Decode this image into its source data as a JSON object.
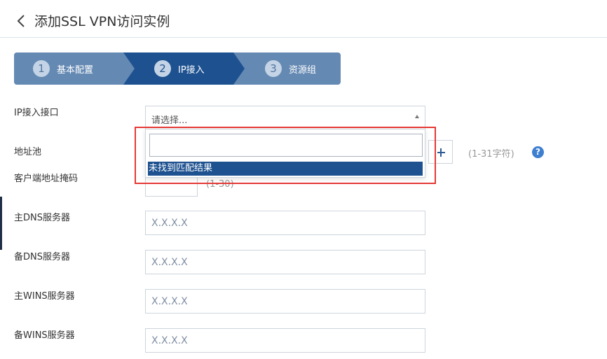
{
  "header": {
    "title": "添加SSL VPN访问实例",
    "back_icon": "chevron-left-icon"
  },
  "steps": [
    {
      "num": "1",
      "label": "基本配置",
      "state": "done"
    },
    {
      "num": "2",
      "label": "IP接入",
      "state": "active"
    },
    {
      "num": "3",
      "label": "资源组",
      "state": "pending"
    }
  ],
  "form": {
    "ip_interface": {
      "label": "IP接入接口",
      "placeholder": "请选择..."
    },
    "dropdown": {
      "search_value": "",
      "no_result": "未找到匹配结果"
    },
    "address_pool": {
      "label": "地址池",
      "hint": "(1-31字符)",
      "add_icon": "plus-icon",
      "help_icon": "question-icon",
      "help_text": "?"
    },
    "client_mask": {
      "label": "客户端地址掩码",
      "hint": "(1-30)"
    },
    "primary_dns": {
      "label": "主DNS服务器",
      "placeholder": "X.X.X.X"
    },
    "secondary_dns": {
      "label": "备DNS服务器",
      "placeholder": "X.X.X.X"
    },
    "primary_wins": {
      "label": "主WINS服务器",
      "placeholder": "X.X.X.X"
    },
    "secondary_wins": {
      "label": "备WINS服务器",
      "placeholder": "X.X.X.X"
    }
  },
  "colors": {
    "accent": "#1d5190",
    "step_inactive": "#6489b3",
    "highlight": "#e53935",
    "help": "#3f7fd0"
  }
}
